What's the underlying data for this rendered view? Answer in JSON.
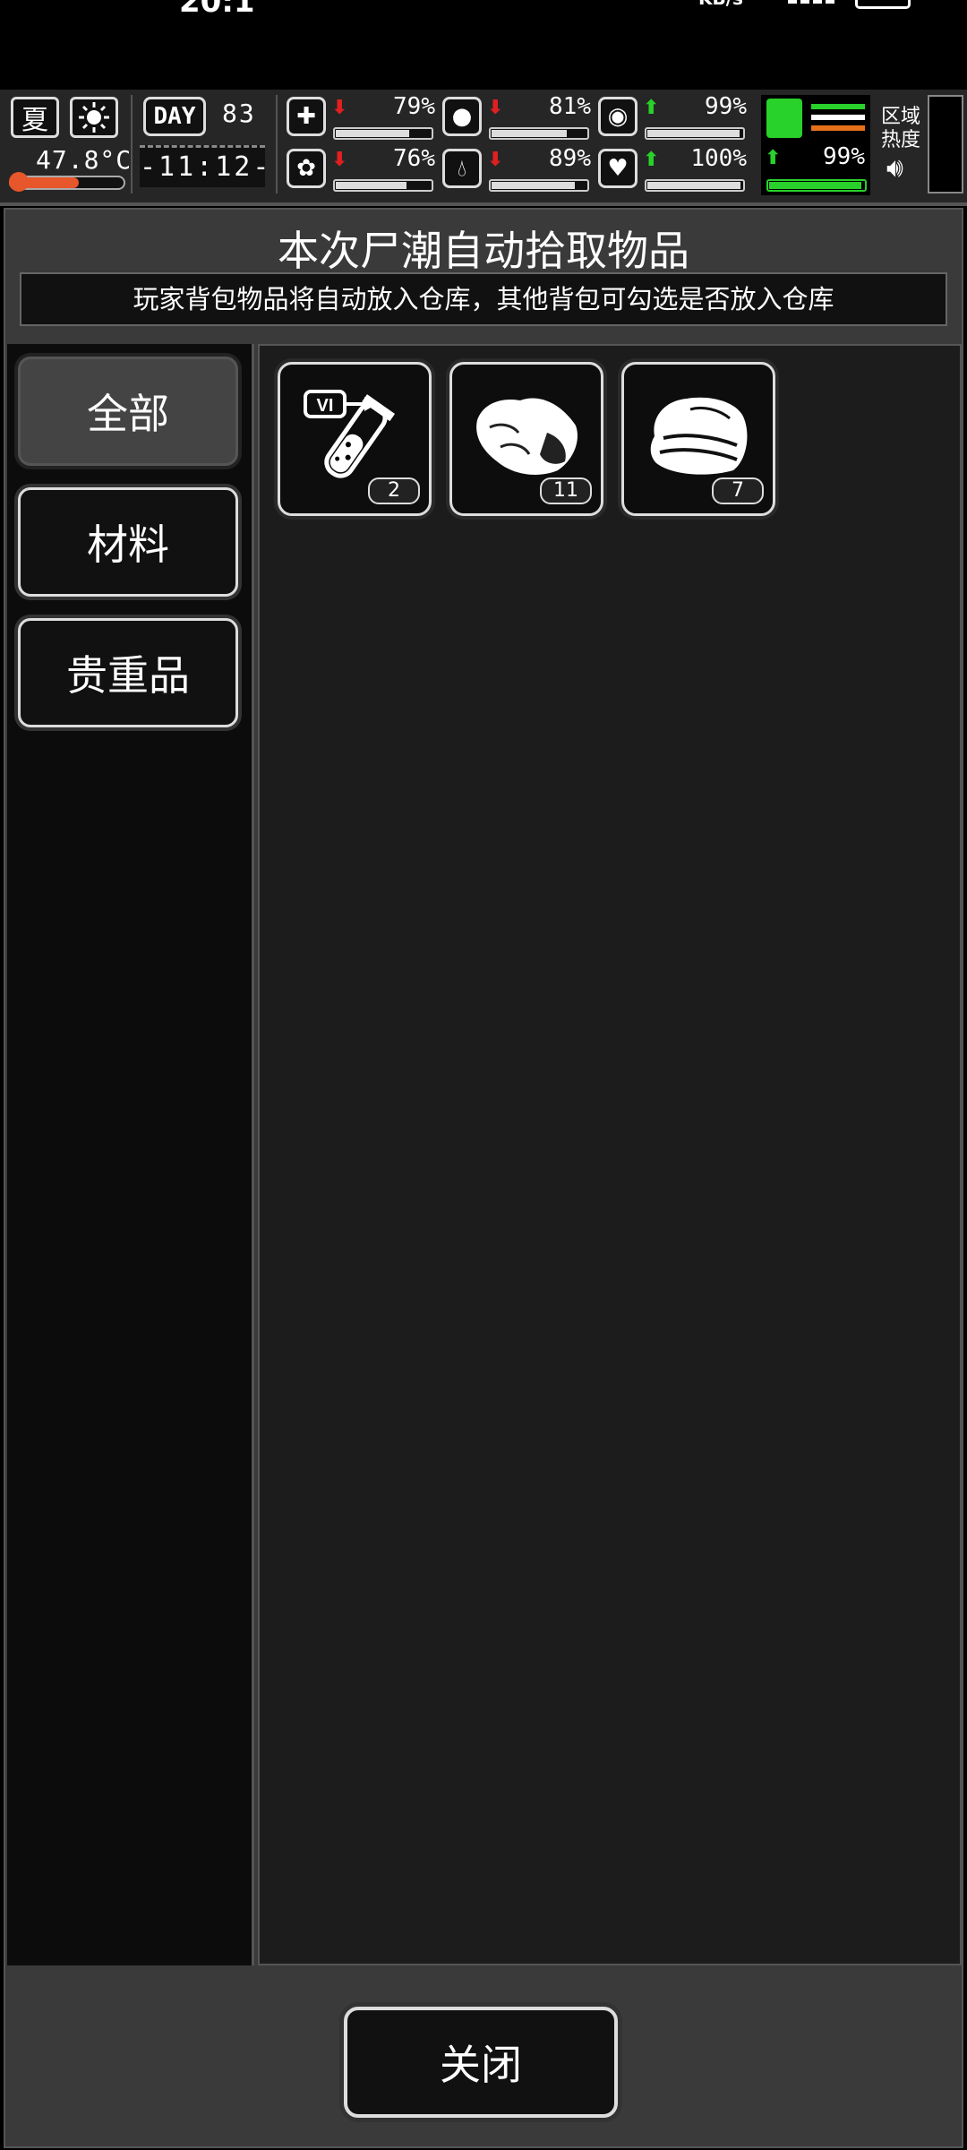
{
  "status_bar": {
    "time": "20:1",
    "net_unit": "KB/s"
  },
  "hud": {
    "season": "夏",
    "temperature": "47.8°C",
    "temperature_level": 0.6,
    "day_label": "DAY",
    "day_number": "83",
    "clock": "-11:12-",
    "stats": [
      {
        "icon": "medkit-icon",
        "trend": "down",
        "value": "79%",
        "level": 0.79
      },
      {
        "icon": "stomach-icon",
        "trend": "down",
        "value": "81%",
        "level": 0.81
      },
      {
        "icon": "pill-icon",
        "trend": "up",
        "value": "99%",
        "level": 0.99
      },
      {
        "icon": "brain-icon",
        "trend": "down",
        "value": "76%",
        "level": 0.76
      },
      {
        "icon": "water-drop-icon",
        "trend": "down",
        "value": "89%",
        "level": 0.89
      },
      {
        "icon": "heart-icon",
        "trend": "up",
        "value": "100%",
        "level": 1.0
      }
    ],
    "stamina": {
      "trend": "up",
      "value": "99%",
      "level": 0.99
    },
    "region_heat": "区域热度",
    "colors": {
      "up": "#29d12b",
      "down": "#e02020",
      "stamina": "#29d12b",
      "thermo": "#e8562b"
    }
  },
  "dialog": {
    "title": "本次尸潮自动拾取物品",
    "notice": "玩家背包物品将自动放入仓库，其他背包可勾选是否放入仓库",
    "categories": [
      {
        "label": "全部",
        "active": true
      },
      {
        "label": "材料",
        "active": false
      },
      {
        "label": "贵重品",
        "active": false
      }
    ],
    "items": [
      {
        "icon": "vaccine-vial-icon",
        "badge": "VI",
        "count": "2"
      },
      {
        "icon": "raw-meat-icon",
        "count": "11"
      },
      {
        "icon": "cloth-icon",
        "count": "7"
      }
    ],
    "close_label": "关闭"
  }
}
